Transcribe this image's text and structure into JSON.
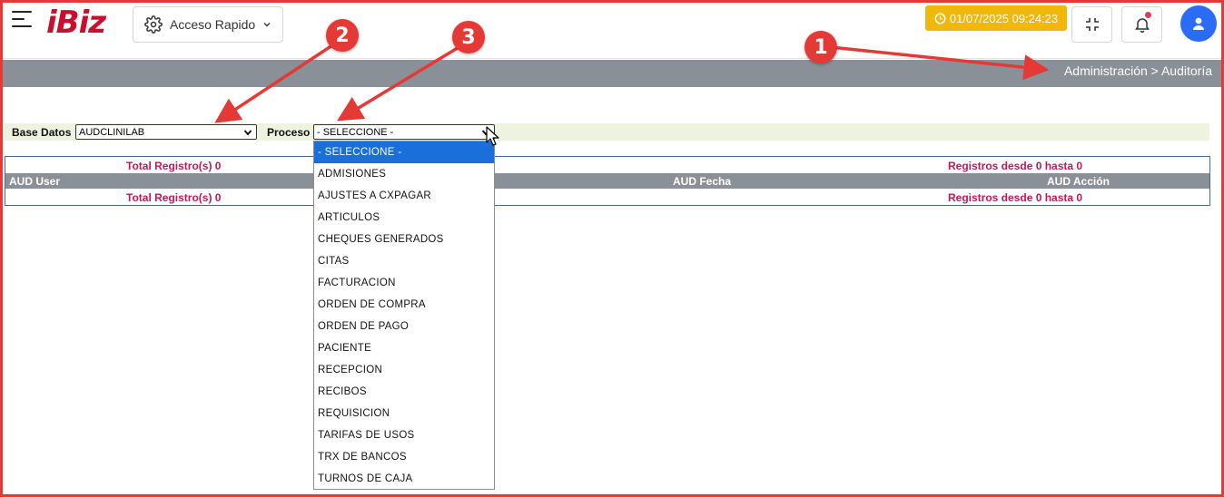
{
  "header": {
    "logo": "iBiz",
    "quick_access_label": "Acceso Rapido",
    "datetime": "01/07/2025 09:24:23"
  },
  "breadcrumb": "Administración > Auditoría",
  "filters": {
    "base_datos_label": "Base Datos",
    "base_datos_value": "AUDCLINILAB",
    "proceso_label": "Proceso",
    "proceso_value": "- SELECCIONE -"
  },
  "table": {
    "total_top": "Total Registro(s) 0",
    "range_top": "Registros desde 0 hasta 0",
    "columns": [
      "AUD User",
      "AUD Fecha",
      "AUD Acción"
    ],
    "total_bottom": "Total Registro(s) 0",
    "range_bottom": "Registros desde 0 hasta 0"
  },
  "dropdown_options": [
    "- SELECCIONE -",
    "ADMISIONES",
    "AJUSTES A CXPAGAR",
    "ARTICULOS",
    "CHEQUES GENERADOS",
    "CITAS",
    "FACTURACION",
    "ORDEN DE COMPRA",
    "ORDEN DE PAGO",
    "PACIENTE",
    "RECEPCION",
    "RECIBOS",
    "REQUISICION",
    "TARIFAS DE USOS",
    "TRX DE BANCOS",
    "TURNOS DE CAJA"
  ],
  "annotations": [
    "1",
    "2",
    "3"
  ],
  "colors": {
    "brand": "#c8102e",
    "date_badge": "#f1b80b",
    "avatar": "#2b6cf6",
    "bar_gray": "#8a9097",
    "record_text": "#c2185b",
    "selected_option": "#1a6fdb",
    "annotation": "#e53935"
  }
}
